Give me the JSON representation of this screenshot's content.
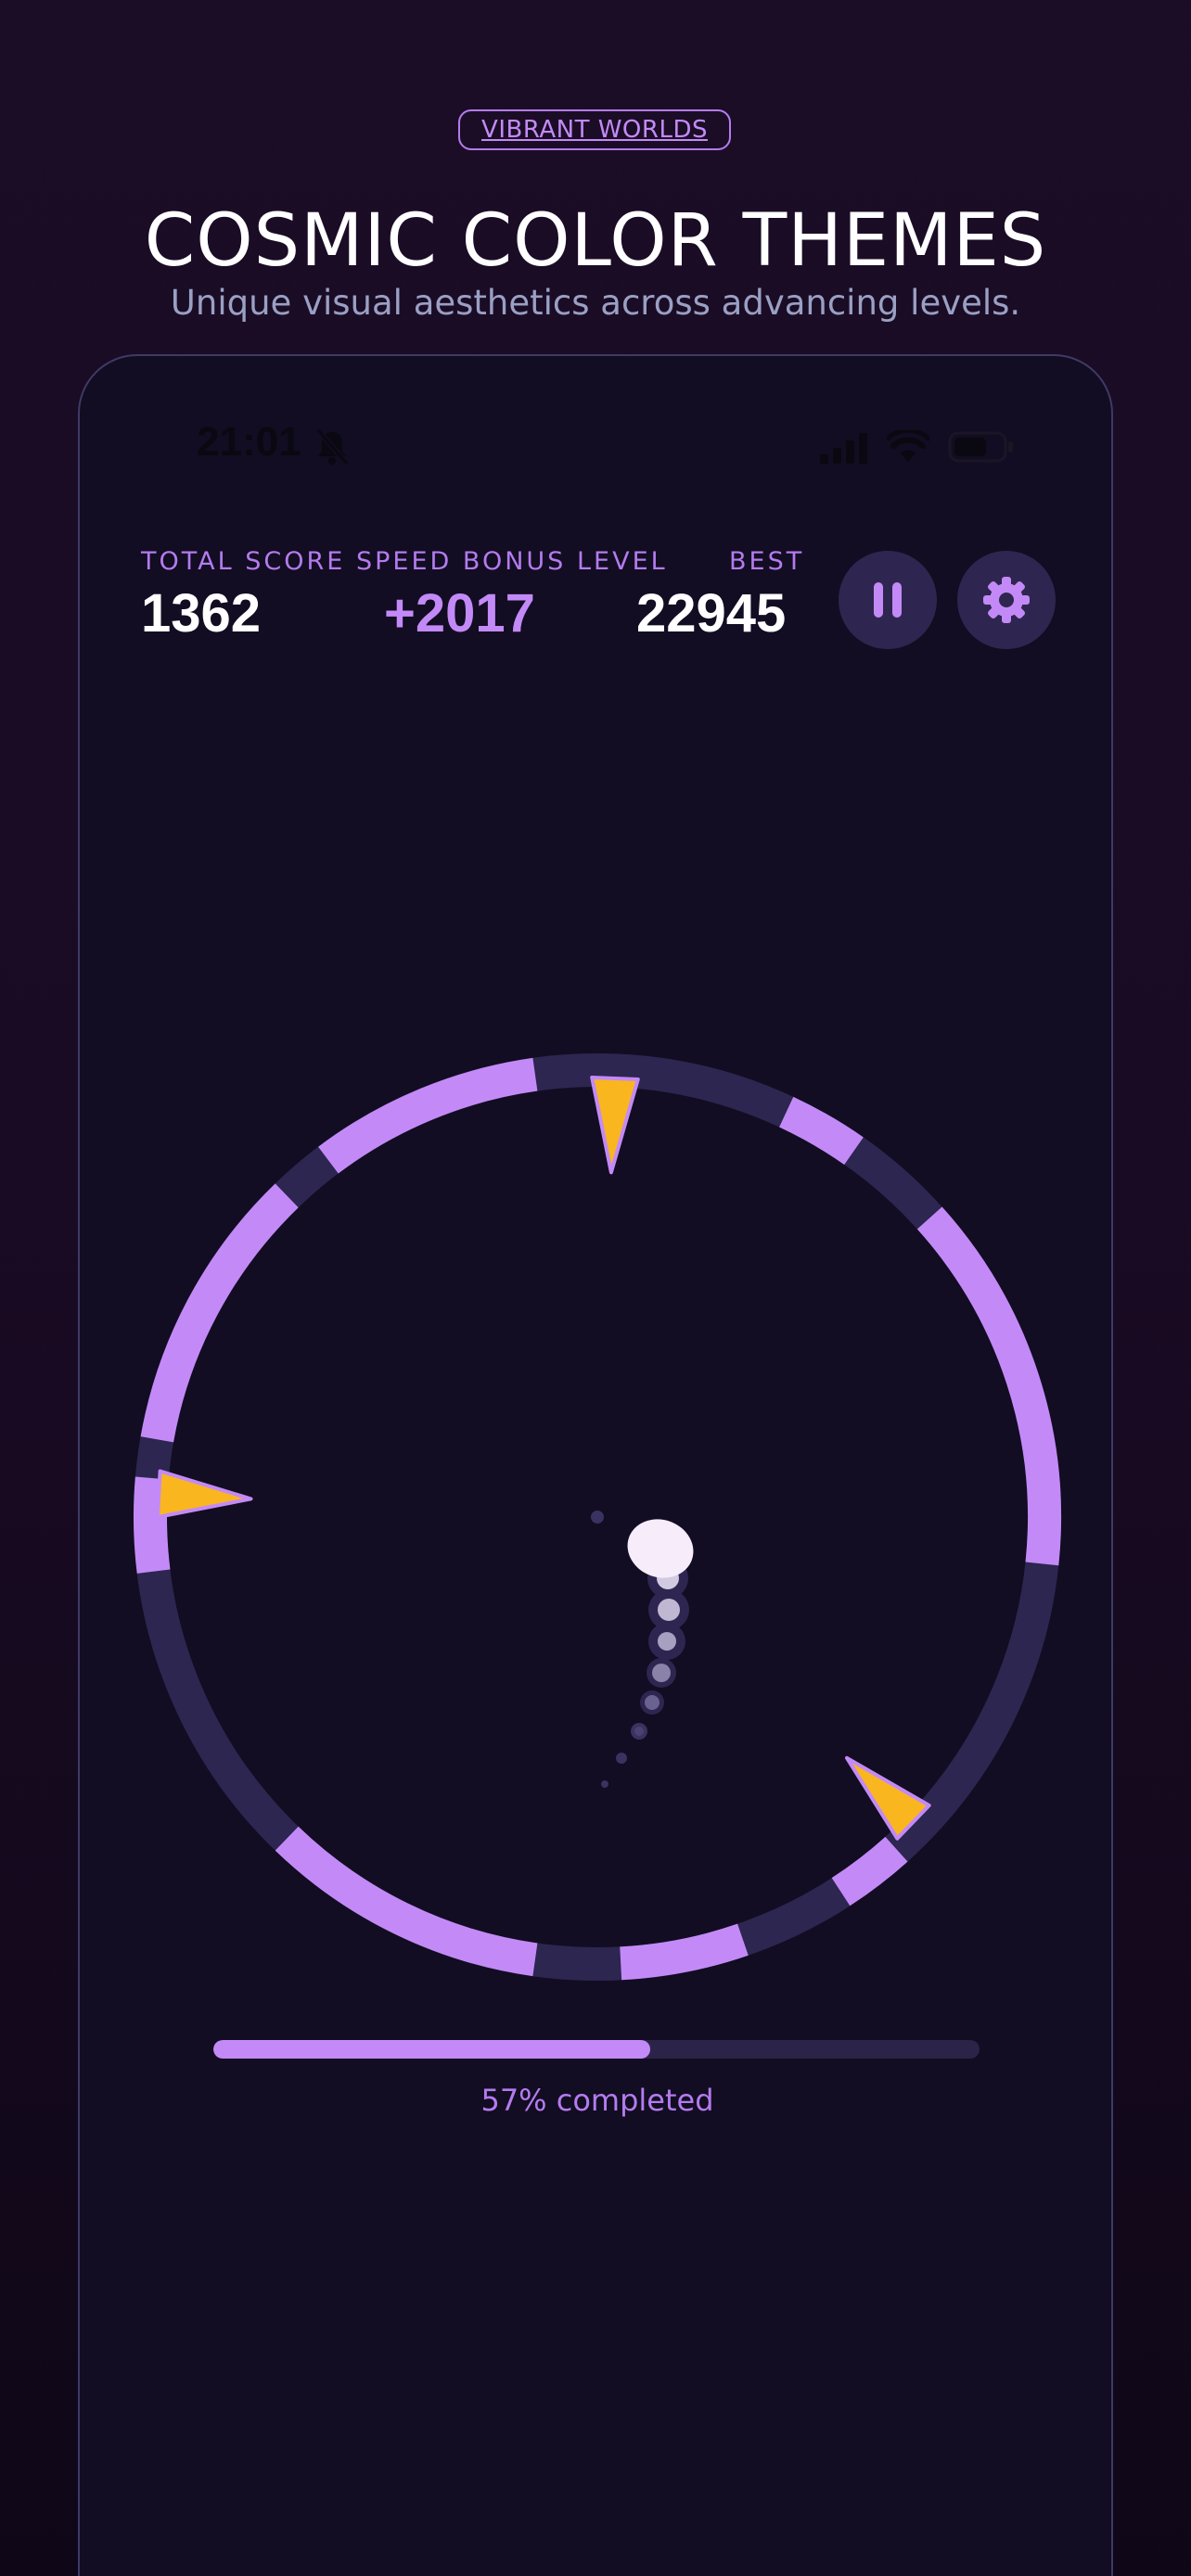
{
  "header": {
    "pill_label": "VIBRANT WORLDS",
    "title": "COSMIC COLOR THEMES",
    "subtitle": "Unique visual aesthetics across advancing levels."
  },
  "status_bar": {
    "time": "21:01",
    "icons": [
      "bell-slash-icon",
      "signal-icon",
      "wifi-icon",
      "battery-icon"
    ]
  },
  "hud": {
    "total_score_label": "TOTAL SCORE",
    "total_score_value": "1362",
    "speed_bonus_label": "SPEED BONUS",
    "speed_bonus_value": "+2017",
    "level_label": "LEVEL",
    "level_value": "",
    "best_label": "BEST",
    "best_value": "22945",
    "pause_icon": "pause-icon",
    "settings_icon": "gear-icon"
  },
  "progress": {
    "fraction": 0.57,
    "text": "57% completed"
  },
  "colors": {
    "accent": "#c38af7",
    "ring_dark": "#2d2650",
    "spike": "#f9b61f",
    "ball": "#f6ecfa",
    "phone_bg": "#120d22"
  }
}
